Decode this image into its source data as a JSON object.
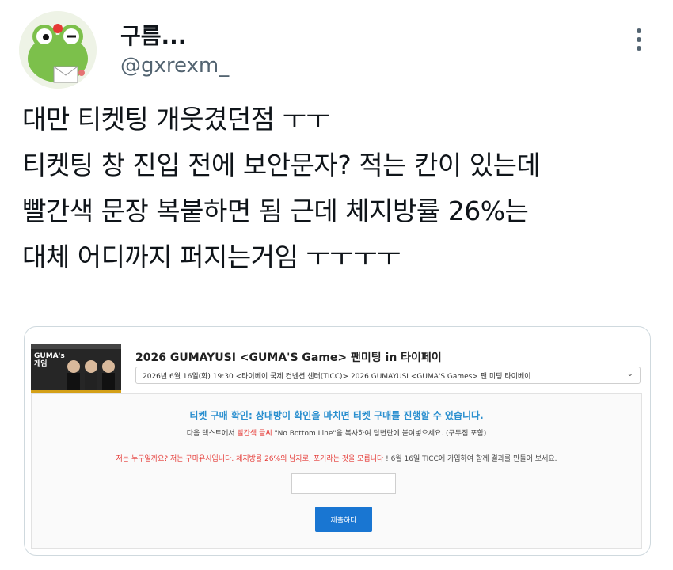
{
  "author": {
    "display_name": "구름...",
    "handle": "@gxrexm_",
    "avatar_icon": "frog-avatar-icon",
    "more_icon": "more-options-icon"
  },
  "tweet": {
    "lines": [
      "대만 티켓팅 개웃겼던점 ㅜㅜ",
      "티켓팅 창 진입 전에 보안문자? 적는 칸이 있는데",
      "빨간색 문장 복붙하면 됨 근데 체지방률 26%는",
      "대체 어디까지 퍼지는거임 ㅜㅜㅜㅜ"
    ]
  },
  "media": {
    "event_title": "2026 GUMAYUSI <GUMA'S Game> 팬미팅 in 타이페이",
    "event_select": "2026년 6월 16일(화) 19:30 <타이베이 국제 컨벤션 센터(TICC)> 2026 GUMAYUSI <GUMA'S Games> 팬 미팅 타이베이",
    "thumb_logo": "GUMA's 게임",
    "verify": {
      "title": "티켓 구매 확인: 상대방이 확인을 마치면 티켓 구매를 진행할 수 있습니다.",
      "instruction_pre": "다음 텍스트에서 ",
      "instruction_red": "빨간색 글씨",
      "instruction_post": " \"No Bottom Line\"을 복사하여 답변란에 붙여넣으세요. (구두점 포함)",
      "phrase_intro": "저는 누구일까요? 저는 구마유시입니다. ",
      "phrase_red": "체지방률 26%의 남자로, 포기라는 것을 모릅니다",
      "phrase_outro": " ! 6월 16일 TICC에 가입하여 함께 결과를 만들어 보세요.",
      "answer_value": "",
      "submit_label": "제출하다"
    }
  },
  "colors": {
    "accent_blue": "#2a8fcf",
    "button_blue": "#1976d2",
    "warning_red": "#e53935"
  }
}
